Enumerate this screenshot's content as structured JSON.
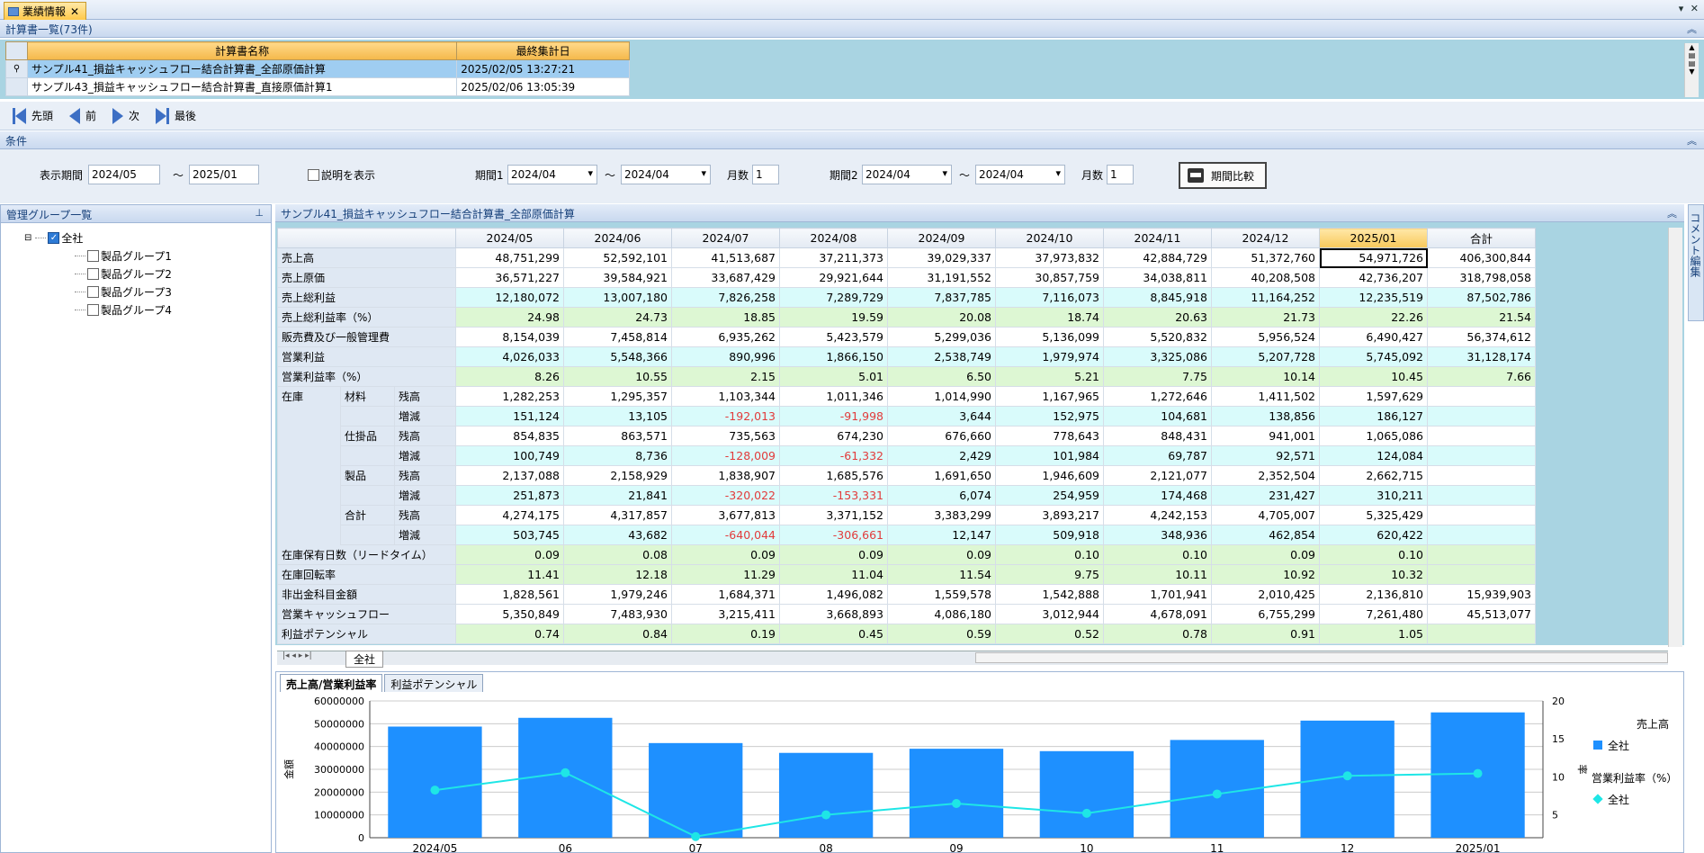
{
  "window": {
    "tab_title": "業績情報"
  },
  "calc_list": {
    "header": "計算書一覧(73件)",
    "columns": [
      "計算書名称",
      "最終集計日"
    ],
    "rows": [
      {
        "name": "サンプル41_損益キャッシュフロー結合計算書_全部原価計算",
        "date": "2025/02/05 13:27:21"
      },
      {
        "name": "サンプル43_損益キャッシュフロー結合計算書_直接原価計算1",
        "date": "2025/02/06 13:05:39"
      }
    ]
  },
  "nav": {
    "first": "先頭",
    "prev": "前",
    "next": "次",
    "last": "最後"
  },
  "conditions": {
    "header": "条件",
    "display_period_label": "表示期間",
    "display_from": "2024/05",
    "tilde": "〜",
    "display_to": "2025/01",
    "show_desc_label": "説明を表示",
    "period1_label": "期間1",
    "period1_from": "2024/04",
    "period1_to": "2024/04",
    "months_label": "月数",
    "period1_months": "1",
    "period2_label": "期間2",
    "period2_from": "2024/04",
    "period2_to": "2024/04",
    "period2_months": "1",
    "compare_button": "期間比較"
  },
  "group_panel": {
    "header": "管理グループ一覧",
    "root": "全社",
    "children": [
      "製品グループ1",
      "製品グループ2",
      "製品グループ3",
      "製品グループ4"
    ]
  },
  "main": {
    "title": "サンプル41_損益キャッシュフロー結合計算書_全部原価計算",
    "columns": [
      "2024/05",
      "2024/06",
      "2024/07",
      "2024/08",
      "2024/09",
      "2024/10",
      "2024/11",
      "2024/12",
      "2025/01",
      "合計"
    ],
    "rows": [
      {
        "l1": "売上高",
        "style": "w",
        "v": [
          "48,751,299",
          "52,592,101",
          "41,513,687",
          "37,211,373",
          "39,029,337",
          "37,973,832",
          "42,884,729",
          "51,372,760",
          "54,971,726",
          "406,300,844"
        ]
      },
      {
        "l1": "売上原価",
        "style": "w",
        "v": [
          "36,571,227",
          "39,584,921",
          "33,687,429",
          "29,921,644",
          "31,191,552",
          "30,857,759",
          "34,038,811",
          "40,208,508",
          "42,736,207",
          "318,798,058"
        ]
      },
      {
        "l1": "売上総利益",
        "style": "c",
        "v": [
          "12,180,072",
          "13,007,180",
          "7,826,258",
          "7,289,729",
          "7,837,785",
          "7,116,073",
          "8,845,918",
          "11,164,252",
          "12,235,519",
          "87,502,786"
        ]
      },
      {
        "l1": "売上総利益率（%）",
        "style": "g",
        "v": [
          "24.98",
          "24.73",
          "18.85",
          "19.59",
          "20.08",
          "18.74",
          "20.63",
          "21.73",
          "22.26",
          "21.54"
        ]
      },
      {
        "l1": "販売費及び一般管理費",
        "style": "w",
        "v": [
          "8,154,039",
          "7,458,814",
          "6,935,262",
          "5,423,579",
          "5,299,036",
          "5,136,099",
          "5,520,832",
          "5,956,524",
          "6,490,427",
          "56,374,612"
        ]
      },
      {
        "l1": "営業利益",
        "style": "c",
        "v": [
          "4,026,033",
          "5,548,366",
          "890,996",
          "1,866,150",
          "2,538,749",
          "1,979,974",
          "3,325,086",
          "5,207,728",
          "5,745,092",
          "31,128,174"
        ]
      },
      {
        "l1": "営業利益率（%）",
        "style": "g",
        "v": [
          "8.26",
          "10.55",
          "2.15",
          "5.01",
          "6.50",
          "5.21",
          "7.75",
          "10.14",
          "10.45",
          "7.66"
        ]
      },
      {
        "l1": "在庫",
        "l2": "材料",
        "l3": "残高",
        "style": "w",
        "v": [
          "1,282,253",
          "1,295,357",
          "1,103,344",
          "1,011,346",
          "1,014,990",
          "1,167,965",
          "1,272,646",
          "1,411,502",
          "1,597,629",
          ""
        ]
      },
      {
        "l1": "",
        "l2": "",
        "l3": "増減",
        "style": "c",
        "v": [
          "151,124",
          "13,105",
          "-192,013",
          "-91,998",
          "3,644",
          "152,975",
          "104,681",
          "138,856",
          "186,127",
          ""
        ]
      },
      {
        "l1": "",
        "l2": "仕掛品",
        "l3": "残高",
        "style": "w",
        "v": [
          "854,835",
          "863,571",
          "735,563",
          "674,230",
          "676,660",
          "778,643",
          "848,431",
          "941,001",
          "1,065,086",
          ""
        ]
      },
      {
        "l1": "",
        "l2": "",
        "l3": "増減",
        "style": "c",
        "v": [
          "100,749",
          "8,736",
          "-128,009",
          "-61,332",
          "2,429",
          "101,984",
          "69,787",
          "92,571",
          "124,084",
          ""
        ]
      },
      {
        "l1": "",
        "l2": "製品",
        "l3": "残高",
        "style": "w",
        "v": [
          "2,137,088",
          "2,158,929",
          "1,838,907",
          "1,685,576",
          "1,691,650",
          "1,946,609",
          "2,121,077",
          "2,352,504",
          "2,662,715",
          ""
        ]
      },
      {
        "l1": "",
        "l2": "",
        "l3": "増減",
        "style": "c",
        "v": [
          "251,873",
          "21,841",
          "-320,022",
          "-153,331",
          "6,074",
          "254,959",
          "174,468",
          "231,427",
          "310,211",
          ""
        ]
      },
      {
        "l1": "",
        "l2": "合計",
        "l3": "残高",
        "style": "w",
        "v": [
          "4,274,175",
          "4,317,857",
          "3,677,813",
          "3,371,152",
          "3,383,299",
          "3,893,217",
          "4,242,153",
          "4,705,007",
          "5,325,429",
          ""
        ]
      },
      {
        "l1": "",
        "l2": "",
        "l3": "増減",
        "style": "c",
        "v": [
          "503,745",
          "43,682",
          "-640,044",
          "-306,661",
          "12,147",
          "509,918",
          "348,936",
          "462,854",
          "620,422",
          ""
        ]
      },
      {
        "l1": "在庫保有日数（リードタイム）",
        "style": "g",
        "v": [
          "0.09",
          "0.08",
          "0.09",
          "0.09",
          "0.09",
          "0.10",
          "0.10",
          "0.09",
          "0.10",
          ""
        ]
      },
      {
        "l1": "在庫回転率",
        "style": "g",
        "v": [
          "11.41",
          "12.18",
          "11.29",
          "11.04",
          "11.54",
          "9.75",
          "10.11",
          "10.92",
          "10.32",
          ""
        ]
      },
      {
        "l1": "非出金科目金額",
        "style": "w",
        "v": [
          "1,828,561",
          "1,979,246",
          "1,684,371",
          "1,496,082",
          "1,559,578",
          "1,542,888",
          "1,701,941",
          "2,010,425",
          "2,136,810",
          "15,939,903"
        ]
      },
      {
        "l1": "営業キャッシュフロー",
        "style": "w",
        "v": [
          "5,350,849",
          "7,483,930",
          "3,215,411",
          "3,668,893",
          "4,086,180",
          "3,012,944",
          "4,678,091",
          "6,755,299",
          "7,261,480",
          "45,513,077"
        ]
      },
      {
        "l1": "利益ポテンシャル",
        "style": "g",
        "v": [
          "0.74",
          "0.84",
          "0.19",
          "0.45",
          "0.59",
          "0.52",
          "0.78",
          "0.91",
          "1.05",
          ""
        ]
      }
    ],
    "sheet_tab": "全社"
  },
  "chart_tabs": [
    "売上高/営業利益率",
    "利益ポテンシャル"
  ],
  "chart_data": {
    "type": "bar",
    "categories": [
      "2024/05",
      "06",
      "07",
      "08",
      "09",
      "10",
      "11",
      "12",
      "2025/01"
    ],
    "series": [
      {
        "name": "全社",
        "kind": "bar",
        "axis": "left",
        "values": [
          48751299,
          52592101,
          41513687,
          37211373,
          39029337,
          37973832,
          42884729,
          51372760,
          54971726
        ],
        "color": "#1e90ff"
      },
      {
        "name": "全社",
        "kind": "line",
        "axis": "right",
        "values": [
          8.26,
          10.55,
          2.15,
          5.01,
          6.5,
          5.21,
          7.75,
          10.14,
          10.45
        ],
        "color": "#1ee6e6"
      }
    ],
    "ylabel": "金額",
    "y2label": "率",
    "ylim": [
      0,
      60000000
    ],
    "y_ticks": [
      "60000000",
      "50000000",
      "40000000",
      "30000000",
      "20000000",
      "10000000",
      "0"
    ],
    "y2lim": [
      2,
      20
    ],
    "y2_ticks": [
      "20",
      "15",
      "10",
      "5"
    ],
    "legend": {
      "bar_title": "売上高",
      "bar_entry": "全社",
      "line_title": "営業利益率（%）",
      "line_entry": "全社",
      "placement": "right"
    }
  },
  "right_strip": "コメント編集"
}
